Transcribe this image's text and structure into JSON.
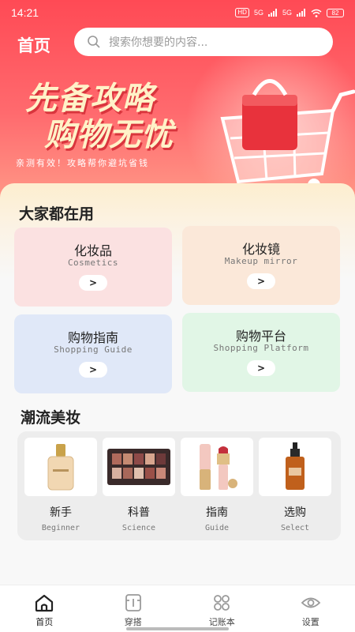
{
  "status_bar": {
    "time": "14:21",
    "hd_badge": "HD",
    "network_1": "5G",
    "network_2": "5G",
    "battery": "82"
  },
  "header": {
    "title": "首页",
    "search_placeholder": "搜索你想要的内容..."
  },
  "banner": {
    "slogan_line1": "先备攻略",
    "slogan_line2": "购物无忧",
    "subtitle": "亲测有效！攻略帮你避坑省钱"
  },
  "section_popular": {
    "title": "大家都在用",
    "cards": [
      {
        "cn": "化妆品",
        "en": "Cosmetics",
        "bg": "#fbe1e1"
      },
      {
        "cn": "化妆镜",
        "en": "Makeup mirror",
        "bg": "#fbe8d9"
      },
      {
        "cn": "购物指南",
        "en": "Shopping Guide",
        "bg": "#e0e8f8"
      },
      {
        "cn": "购物平台",
        "en": "Shopping Platform",
        "bg": "#e1f6e6"
      }
    ],
    "arrow": ">"
  },
  "section_beauty": {
    "title": "潮流美妆",
    "items": [
      {
        "cn": "新手",
        "en": "Beginner"
      },
      {
        "cn": "科普",
        "en": "Science"
      },
      {
        "cn": "指南",
        "en": "Guide"
      },
      {
        "cn": "选购",
        "en": "Select"
      }
    ]
  },
  "tabbar": {
    "tabs": [
      {
        "label": "首页",
        "icon": "home-icon"
      },
      {
        "label": "穿搭",
        "icon": "outfit-icon"
      },
      {
        "label": "记账本",
        "icon": "grid-icon"
      },
      {
        "label": "设置",
        "icon": "settings-icon"
      }
    ]
  },
  "colors": {
    "accent": "#ff4a55",
    "tab_icon": "#9a9a9a"
  }
}
